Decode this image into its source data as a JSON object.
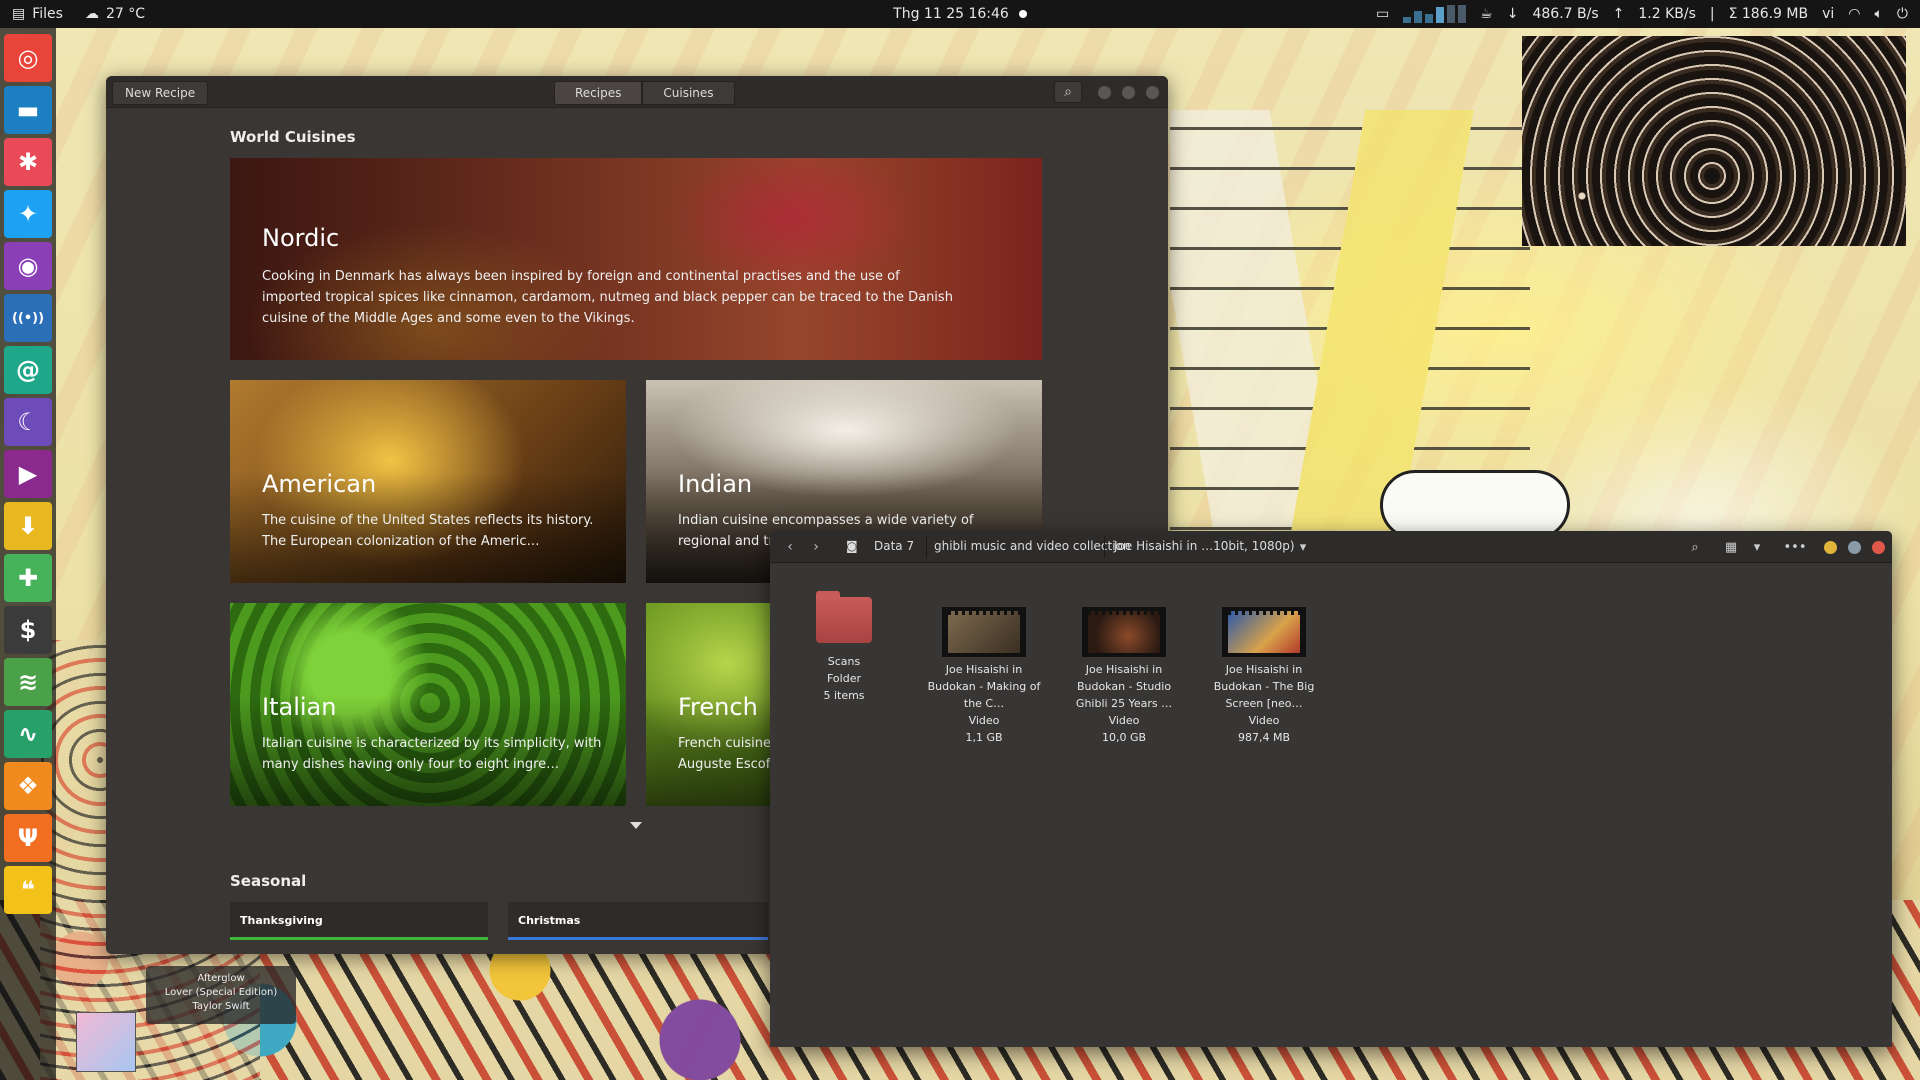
{
  "top_panel": {
    "app_name": "Files",
    "weather": "27 °C",
    "clock": "Thg 11 25  16:46",
    "net_down": "486.7 B/s",
    "net_up": "1.2 KB/s",
    "net_total": "Σ 186.9 MB",
    "language": "vi"
  },
  "dock": {
    "items": [
      {
        "name": "chrome",
        "color": "#e8443a",
        "glyph": "◎"
      },
      {
        "name": "files",
        "color": "#1b7fc2",
        "glyph": "▬"
      },
      {
        "name": "pinwheel",
        "color": "#e94a58",
        "glyph": "✱"
      },
      {
        "name": "twitter",
        "color": "#1da1f2",
        "glyph": "✦"
      },
      {
        "name": "podcasts",
        "color": "#8b3fb6",
        "glyph": "◉"
      },
      {
        "name": "radio",
        "color": "#2a6fb8",
        "glyph": "((•))"
      },
      {
        "name": "mail",
        "color": "#1fa78a",
        "glyph": "@"
      },
      {
        "name": "moonlight",
        "color": "#6d4bb8",
        "glyph": "☾"
      },
      {
        "name": "videos",
        "color": "#8a2a8e",
        "glyph": "▶"
      },
      {
        "name": "downloader",
        "color": "#e8b821",
        "glyph": "⬇"
      },
      {
        "name": "games",
        "color": "#46b25a",
        "glyph": "✚"
      },
      {
        "name": "money",
        "color": "#3b3b3b",
        "glyph": "$"
      },
      {
        "name": "feeds",
        "color": "#4aa14a",
        "glyph": "≋"
      },
      {
        "name": "monitor",
        "color": "#27a06a",
        "glyph": "∿"
      },
      {
        "name": "pineapple",
        "color": "#f08a1f",
        "glyph": "❖"
      },
      {
        "name": "recipes",
        "color": "#f26f21",
        "glyph": "Ψ"
      },
      {
        "name": "chat",
        "color": "#f2c21b",
        "glyph": "❝"
      }
    ]
  },
  "recipes": {
    "new_recipe_label": "New Recipe",
    "tabs": [
      "Recipes",
      "Cuisines"
    ],
    "world_cuisines_title": "World Cuisines",
    "cuisines": [
      {
        "name": "Nordic",
        "desc": "Cooking in Denmark has always been inspired by foreign and continental practises and the use of imported tropical spices like cinnamon, cardamom, nutmeg and black pepper can be traced to the Danish cuisine of the Middle Ages and some even to the Vikings."
      },
      {
        "name": "American",
        "desc": "The cuisine of the United States reflects its history. The European colonization of the Americ…"
      },
      {
        "name": "Indian",
        "desc": "Indian cuisine encompasses a wide variety of regional and tr"
      },
      {
        "name": "Italian",
        "desc": "Italian cuisine is characterized by its simplicity, with many dishes having only four to eight ingre…"
      },
      {
        "name": "French",
        "desc": "French cuisine Auguste Escoff"
      }
    ],
    "seasonal_title": "Seasonal",
    "seasonal": [
      "Thanksgiving",
      "Christmas"
    ]
  },
  "files": {
    "breadcrumbs": [
      "Data 7",
      "ghibli music and video collection",
      "Joe Hisaishi in …10bit, 1080p)"
    ],
    "items": [
      {
        "name": "Scans",
        "type": "Folder",
        "size": "5 items"
      },
      {
        "name": "Joe Hisaishi in Budokan - Making of the C…",
        "type": "Video",
        "size": "1,1  GB"
      },
      {
        "name": "Joe Hisaishi in Budokan - Studio Ghibli 25 Years …",
        "type": "Video",
        "size": "10,0  GB"
      },
      {
        "name": "Joe Hisaishi in Budokan - The Big Screen [neo…",
        "type": "Video",
        "size": "987,4  MB"
      }
    ]
  },
  "music": {
    "title": "Afterglow",
    "album": "Lover (Special Edition)",
    "artist": "Taylor Swift"
  }
}
